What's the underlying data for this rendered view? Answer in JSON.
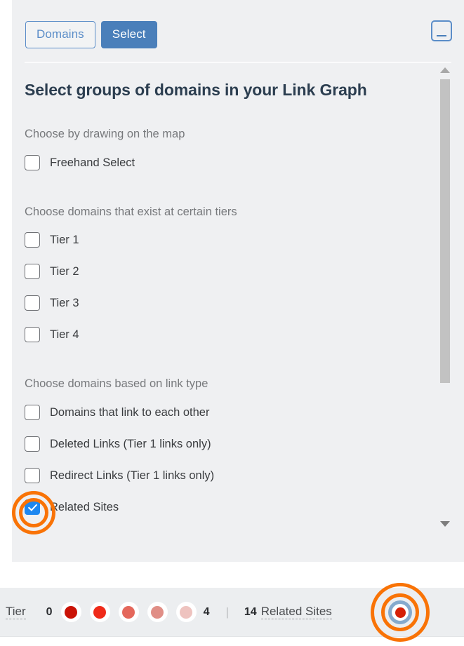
{
  "panel": {
    "header": {
      "buttons": [
        {
          "label": "Domains",
          "style": "outline"
        },
        {
          "label": "Select",
          "style": "primary"
        }
      ],
      "collapse_icon": "collapse-panel-icon"
    },
    "title": "Select groups of domains in your Link Graph",
    "groups": [
      {
        "label": "Choose by drawing on the map",
        "options": [
          {
            "label": "Freehand Select",
            "checked": false
          }
        ]
      },
      {
        "label": "Choose domains that exist at certain tiers",
        "options": [
          {
            "label": "Tier 1",
            "checked": false
          },
          {
            "label": "Tier 2",
            "checked": false
          },
          {
            "label": "Tier 3",
            "checked": false
          },
          {
            "label": "Tier 4",
            "checked": false
          }
        ]
      },
      {
        "label": "Choose domains based on link type",
        "options": [
          {
            "label": "Domains that link to each other",
            "checked": false
          },
          {
            "label": "Deleted Links (Tier 1 links only)",
            "checked": false
          },
          {
            "label": "Redirect Links (Tier 1 links only)",
            "checked": false
          },
          {
            "label": "Related Sites",
            "checked": true
          }
        ]
      }
    ],
    "scrollbar": {
      "up_arrow": "scroll-up-arrow-icon",
      "down_arrow": "scroll-down-arrow-icon"
    }
  },
  "bottom_bar": {
    "tier_label": "Tier",
    "tier_min": "0",
    "tier_max": "4",
    "tier_dot_colors": [
      "#ca1206",
      "#ef2a19",
      "#e4675b",
      "#e08e86",
      "#eec3bf"
    ],
    "divider": "|",
    "related_count": "14",
    "related_label": "Related Sites",
    "related_marker": {
      "outer_color": "#85aacd",
      "mid_color": "#ffffff",
      "core_color": "#d52108"
    }
  },
  "annotation": {
    "color": "#f97306",
    "targets": [
      "related-sites-checkbox",
      "related-sites-marker"
    ]
  }
}
